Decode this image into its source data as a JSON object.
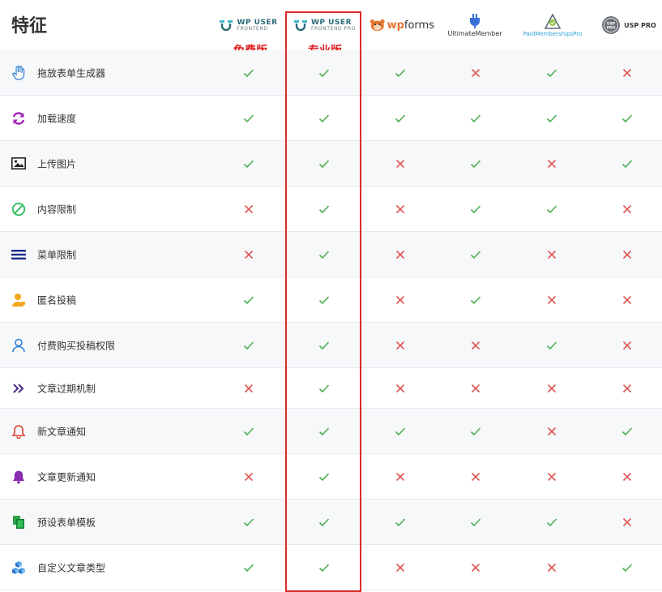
{
  "header": {
    "title": "特征",
    "brands": {
      "wpuf_free": {
        "line1": "WP USER",
        "line2": "FRONTEND"
      },
      "wpuf_pro": {
        "line1": "WP USER",
        "line2": "FRONTEND PRO"
      },
      "wpforms": {
        "prefix": "wp",
        "suffix": "forms"
      },
      "ultimate_member": {
        "name": "UltimateMember"
      },
      "paid_memberships_pro": {
        "name": "PaidMembershipsPro"
      },
      "usp_pro": {
        "name": "USP PRO",
        "seal": "USP PRO"
      }
    },
    "badges": {
      "free": "免费版",
      "pro": "专业版"
    }
  },
  "colors": {
    "check": "#4caf50",
    "cross": "#e05757",
    "highlight": "#d92b2b"
  },
  "columns": [
    "wpuf_free",
    "wpuf_pro",
    "wpforms",
    "ultimate_member",
    "paid_memberships_pro",
    "usp_pro"
  ],
  "rows": [
    {
      "label": "拖放表单生成器",
      "icon": "hand-icon",
      "values": [
        true,
        true,
        true,
        false,
        true,
        false
      ]
    },
    {
      "label": "加载速度",
      "icon": "refresh-icon",
      "values": [
        true,
        true,
        true,
        true,
        true,
        true
      ]
    },
    {
      "label": "上传图片",
      "icon": "image-icon",
      "values": [
        true,
        true,
        false,
        true,
        false,
        true
      ]
    },
    {
      "label": "内容限制",
      "icon": "ban-icon",
      "values": [
        false,
        true,
        false,
        true,
        true,
        false
      ]
    },
    {
      "label": "菜单限制",
      "icon": "menu-icon",
      "values": [
        false,
        true,
        false,
        true,
        false,
        false
      ]
    },
    {
      "label": "匿名投稿",
      "icon": "user-icon",
      "values": [
        true,
        true,
        false,
        true,
        false,
        false
      ]
    },
    {
      "label": "付费购买投稿权限",
      "icon": "user-outline-icon",
      "values": [
        true,
        true,
        false,
        false,
        true,
        false
      ]
    },
    {
      "label": "文章过期机制",
      "icon": "double-chevron-icon",
      "values": [
        false,
        true,
        false,
        false,
        false,
        false
      ]
    },
    {
      "label": "新文章通知",
      "icon": "bell-outline-icon",
      "values": [
        true,
        true,
        true,
        true,
        false,
        true
      ]
    },
    {
      "label": "文章更新通知",
      "icon": "bell-icon",
      "values": [
        false,
        true,
        false,
        false,
        false,
        false
      ]
    },
    {
      "label": "预设表单模板",
      "icon": "copy-icon",
      "values": [
        true,
        true,
        true,
        true,
        true,
        false
      ]
    },
    {
      "label": "自定义文章类型",
      "icon": "cubes-icon",
      "values": [
        true,
        true,
        false,
        false,
        false,
        true
      ]
    }
  ]
}
